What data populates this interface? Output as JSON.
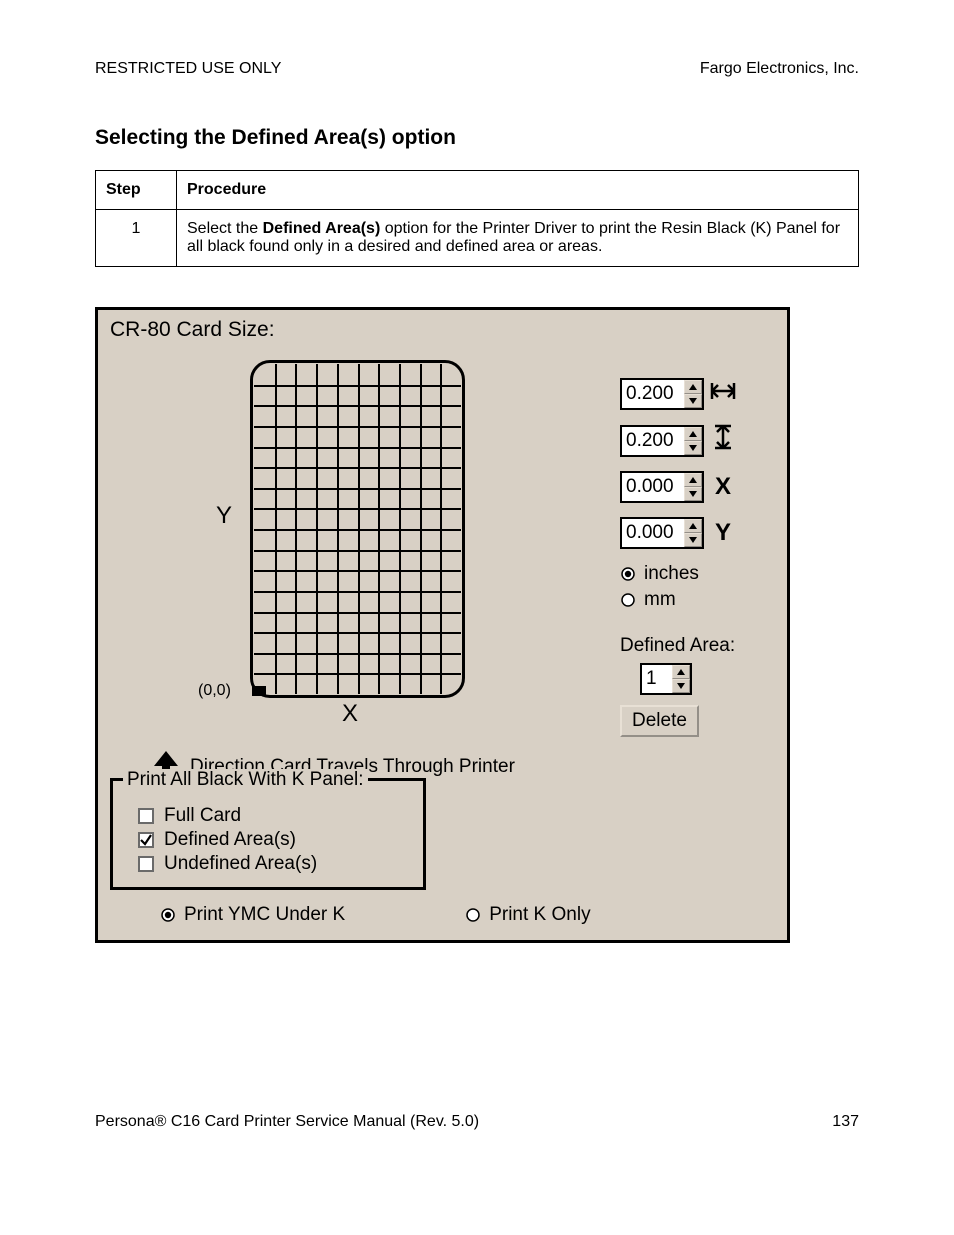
{
  "header": {
    "restricted": "RESTRICTED USE ONLY",
    "company": "Fargo Electronics, Inc."
  },
  "title": "Selecting the Defined Area(s) option",
  "table": {
    "headers": {
      "step": "Step",
      "procedure": "Procedure"
    },
    "rows": [
      {
        "step": "1",
        "pre": "Select the ",
        "bold": "Defined Area(s)",
        "post": " option for the Printer Driver to print the Resin Black (K) Panel for all black found only in a desired and defined area or areas."
      }
    ]
  },
  "panel": {
    "title": "CR-80 Card Size:",
    "grid": {
      "cols": 10,
      "rows": 16,
      "origin_label": "(0,0)",
      "x_axis": "X",
      "y_axis": "Y"
    },
    "direction": "Direction Card Travels Through Printer",
    "spinners": {
      "width": {
        "value": "0.200",
        "icon": "width-icon"
      },
      "height": {
        "value": "0.200",
        "icon": "height-icon"
      },
      "x": {
        "value": "0.000",
        "icon_text": "X"
      },
      "y": {
        "value": "0.000",
        "icon_text": "Y"
      }
    },
    "units": {
      "inches": {
        "label": "inches",
        "selected": true
      },
      "mm": {
        "label": "mm",
        "selected": false
      }
    },
    "defined_area": {
      "label": "Defined Area:",
      "value": "1",
      "delete": "Delete"
    },
    "kpanel": {
      "legend": "Print All Black With K Panel:",
      "full": {
        "label": "Full Card",
        "checked": false
      },
      "defined": {
        "label": "Defined Area(s)",
        "checked": true
      },
      "undefined": {
        "label": "Undefined Area(s)",
        "checked": false
      }
    },
    "under_k": {
      "ymc": {
        "label": "Print YMC Under K",
        "selected": true
      },
      "konly": {
        "label": "Print K Only",
        "selected": false
      }
    }
  },
  "footer": {
    "manual": "Persona® C16 Card Printer Service Manual (Rev. 5.0)",
    "page": "137"
  }
}
